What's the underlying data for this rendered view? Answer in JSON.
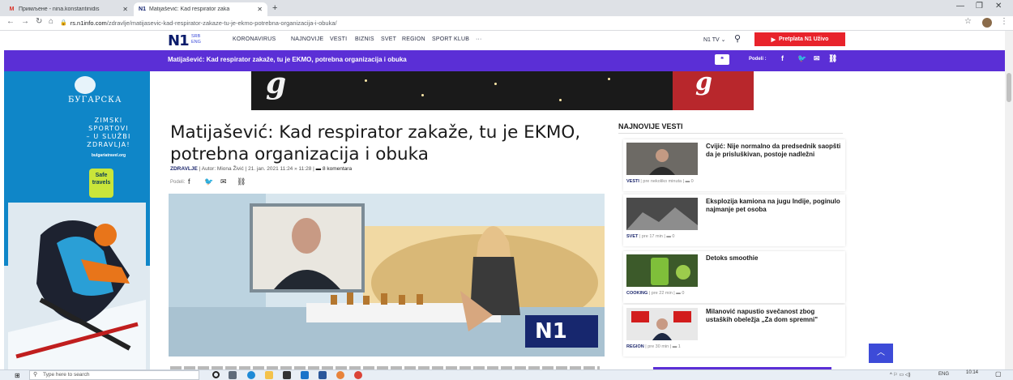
{
  "browser": {
    "tabs": [
      {
        "favicon": "M",
        "title": "Примљене - nina.konstantinidis",
        "active": false
      },
      {
        "favicon": "N1",
        "title": "Matijašević: Kad respirator zaka",
        "active": true
      }
    ],
    "new_tab": "+",
    "url_host": "rs.n1info.com",
    "url_path": "/zdravlje/matijasevic-kad-respirator-zakaze-tu-je-ekmo-potrebna-organizacija-i-obuka/"
  },
  "site": {
    "logo": "N1",
    "lang_primary": "SRB",
    "lang_secondary": "ENG",
    "menu": [
      "KORONAVIRUS",
      "NAJNOVIJE",
      "VESTI",
      "BIZNIS",
      "SVET",
      "REGION",
      "SPORT KLUB",
      "···"
    ],
    "n1tv": "N1 TV",
    "subscribe": "Pretplata N1 Uživo"
  },
  "sticky": {
    "title": "Matijašević: Kad respirator zakaže, tu je EKMO, potrebna organizacija i obuka",
    "share_label": "Podeli :"
  },
  "ad": {
    "brand": "БУГАРСКА",
    "lines": [
      "ZIMSKI",
      "SPORTOVI",
      "– U SLUŽBI",
      "ZDRAVLJA!"
    ],
    "url": "bulgariatravel.org",
    "badge": "Safe travels"
  },
  "article": {
    "headline": "Matijašević: Kad respirator zakaže, tu je EKMO, potrebna organizacija i obuka",
    "category": "ZDRAVLJE",
    "author": "Autor: Miona Živić",
    "date": "21. jan. 2021 11:24 » 11:28",
    "comments": "8 komentara",
    "share_label": "Podeli:",
    "photo_watermark": "N1"
  },
  "sidebar": {
    "heading": "NAJNOVIJE VESTI",
    "items": [
      {
        "title": "Cvijić: Nije normalno da predsednik saopšti da je prisluškivan, postoje nadležni",
        "category": "VESTI",
        "time": "pre nekoliko minuta",
        "comments": "0"
      },
      {
        "title": "Eksplozija kamiona na jugu Indije, poginulo najmanje pet osoba",
        "category": "SVET",
        "time": "pre 17 min",
        "comments": "0"
      },
      {
        "title": "Detoks smoothie",
        "category": "COOKING",
        "time": "pre 22 min",
        "comments": "0"
      },
      {
        "title": "Milanović napustio svečanost zbog ustaških obeležja „Za dom spremni\"",
        "category": "REGION",
        "time": "pre 30 min",
        "comments": "1"
      }
    ]
  },
  "taskbar": {
    "search_placeholder": "Type here to search",
    "lang": "ENG",
    "time": "10:14"
  },
  "colors": {
    "accent_purple": "#5b2fd6",
    "brand_navy": "#0b1c6b",
    "subscribe_red": "#e8232b"
  }
}
